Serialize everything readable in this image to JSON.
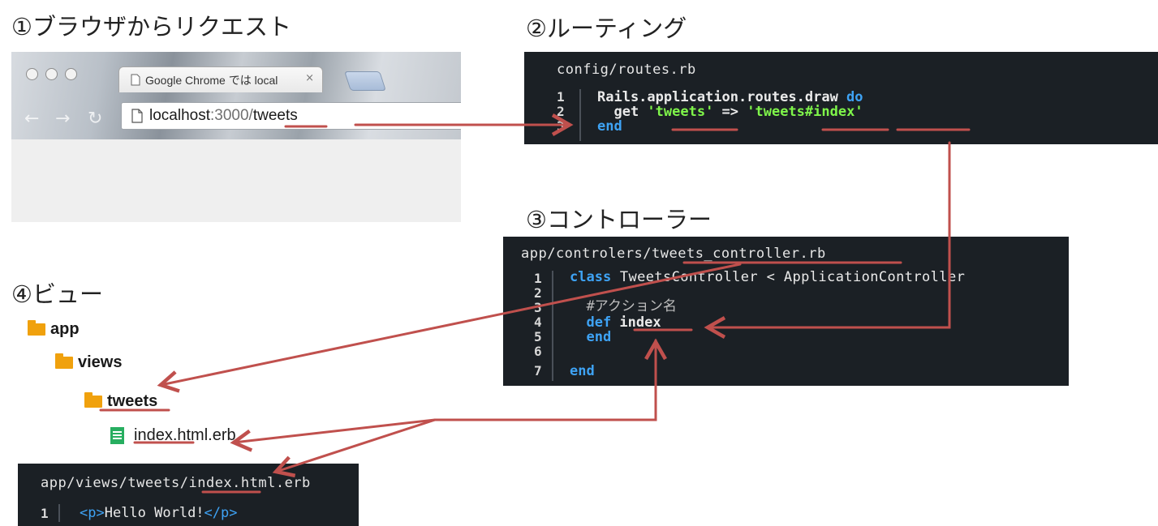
{
  "headings": {
    "step1": "①ブラウザからリクエスト",
    "step2": "②ルーティング",
    "step3": "③コントローラー",
    "step4": "④ビュー"
  },
  "browser": {
    "tab_title": "Google Chrome では local",
    "tab_close": "×",
    "url_host": "localhost",
    "url_port": ":3000/",
    "url_path": "tweets"
  },
  "routes_panel": {
    "title": "config/routes.rb",
    "line_numbers": [
      "1",
      "2",
      "3"
    ],
    "line1_a": "Rails.application.routes.draw ",
    "line1_kw": "do",
    "line2_a": "  get ",
    "line2_str1": "'tweets'",
    "line2_op": " => ",
    "line2_str2": "'tweets#index'",
    "line3_kw": "end"
  },
  "controller_panel": {
    "title": "app/controlers/tweets_controller.rb",
    "line_numbers": [
      "1",
      "2",
      "3",
      "4",
      "5",
      "6",
      "7"
    ],
    "line1_kw": "class",
    "line1_rest": " TweetsController < ApplicationController",
    "line3_comment": "  #アクション名",
    "line4_kw": "  def",
    "line4_rest": " index",
    "line5_kw": "  end",
    "line7_kw": "end"
  },
  "tree": {
    "app": "app",
    "views": "views",
    "tweets": "tweets",
    "file": "index.html.erb"
  },
  "view_panel": {
    "title": "app/views/tweets/index.html.erb",
    "line_number": "1",
    "code_open": "<p>",
    "code_text": "Hello World!",
    "code_close": "</p>"
  },
  "colors": {
    "arrow": "#c0504d",
    "code_bg": "#1b2025",
    "keyword": "#3ea3f5",
    "string": "#7ff54a",
    "folder": "#f0a10d",
    "file": "#27ae60"
  }
}
